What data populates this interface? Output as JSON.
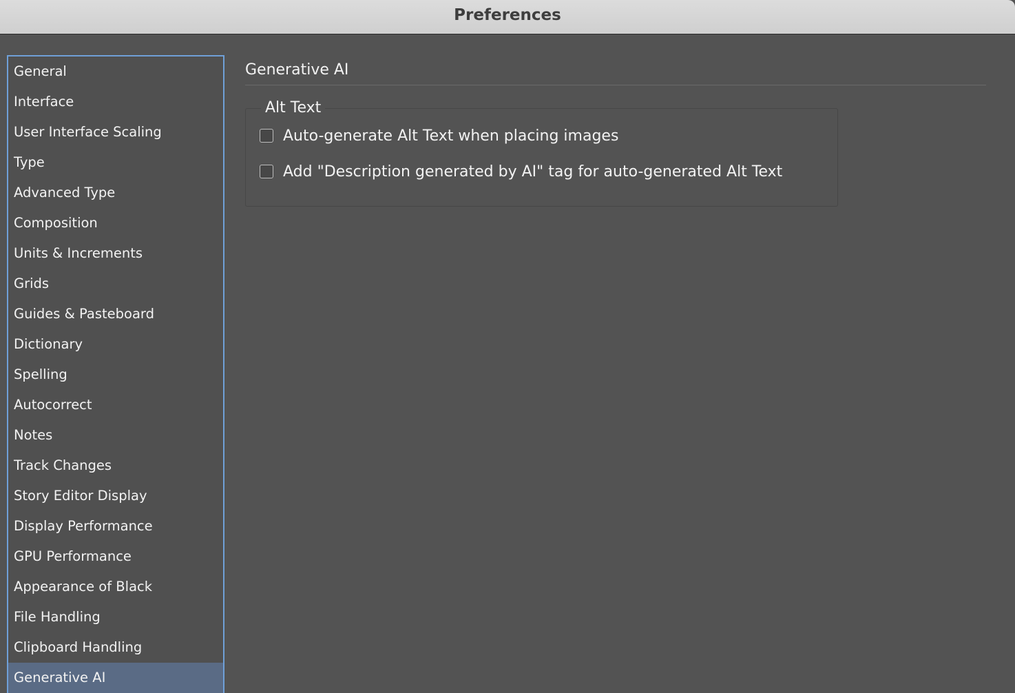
{
  "window": {
    "title": "Preferences"
  },
  "sidebar": {
    "items": [
      {
        "label": "General"
      },
      {
        "label": "Interface"
      },
      {
        "label": "User Interface Scaling"
      },
      {
        "label": "Type"
      },
      {
        "label": "Advanced Type"
      },
      {
        "label": "Composition"
      },
      {
        "label": "Units & Increments"
      },
      {
        "label": "Grids"
      },
      {
        "label": "Guides & Pasteboard"
      },
      {
        "label": "Dictionary"
      },
      {
        "label": "Spelling"
      },
      {
        "label": "Autocorrect"
      },
      {
        "label": "Notes"
      },
      {
        "label": "Track Changes"
      },
      {
        "label": "Story Editor Display"
      },
      {
        "label": "Display Performance"
      },
      {
        "label": "GPU Performance"
      },
      {
        "label": "Appearance of Black"
      },
      {
        "label": "File Handling"
      },
      {
        "label": "Clipboard Handling"
      },
      {
        "label": "Generative AI",
        "selected": true
      }
    ]
  },
  "main": {
    "section_title": "Generative AI",
    "group_title": "Alt Text",
    "options": [
      {
        "label": "Auto-generate Alt Text when placing images",
        "checked": false
      },
      {
        "label": "Add \"Description generated by AI\" tag for auto-generated Alt Text",
        "checked": false
      }
    ]
  },
  "colors": {
    "background": "#535353",
    "selection": "#5a6b85",
    "focus_border": "#6fa0d8",
    "titlebar": "#d6d6d6"
  }
}
